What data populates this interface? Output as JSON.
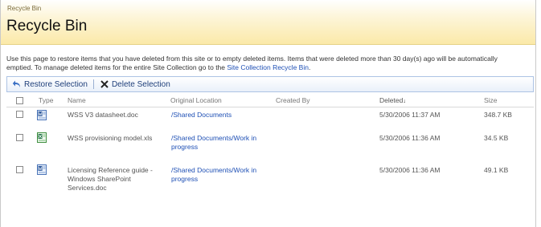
{
  "header": {
    "breadcrumb": "Recycle Bin",
    "title": "Recycle Bin"
  },
  "description": {
    "text": "Use this page to restore items that you have deleted from this site or to empty deleted items. Items that were deleted more than 30 day(s) ago will be automatically emptied. To manage deleted items for the entire Site Collection go to the ",
    "link": "Site Collection Recycle Bin",
    "end": "."
  },
  "toolbar": {
    "restore_label": "Restore Selection",
    "delete_label": "Delete Selection"
  },
  "table": {
    "columns": {
      "type": "Type",
      "name": "Name",
      "original_location": "Original Location",
      "created_by": "Created By",
      "deleted": "Deleted",
      "size": "Size"
    },
    "sort_indicator": "↓",
    "rows": [
      {
        "icon": "word-document-icon",
        "name": "WSS V3 datasheet.doc",
        "location": "/Shared Documents",
        "created_by": "",
        "deleted": "5/30/2006 11:37 AM",
        "size": "348.7 KB"
      },
      {
        "icon": "excel-workbook-icon",
        "name": "WSS provisioning model.xls",
        "location": "/Shared Documents/Work in progress",
        "created_by": "",
        "deleted": "5/30/2006 11:36 AM",
        "size": "34.5 KB"
      },
      {
        "icon": "word-document-icon",
        "name": "Licensing Reference guide - Windows SharePoint Services.doc",
        "location": "/Shared Documents/Work in progress",
        "created_by": "",
        "deleted": "5/30/2006 11:36 AM",
        "size": "49.1 KB"
      }
    ]
  },
  "colors": {
    "link": "#1f50b5",
    "header_gradient_end": "#fbe9a8",
    "toolbar_border": "#adc3e4"
  }
}
